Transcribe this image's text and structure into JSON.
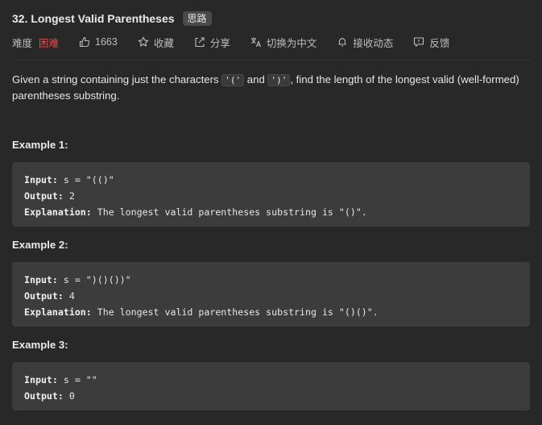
{
  "problem": {
    "title": "32. Longest Valid Parentheses",
    "tag": "思路"
  },
  "meta": {
    "difficulty_label": "难度",
    "difficulty_value": "困难",
    "likes": "1663",
    "favorite": "收藏",
    "share": "分享",
    "translate": "切换为中文",
    "subscribe": "接收动态",
    "feedback": "反馈"
  },
  "description": {
    "part1": "Given a string containing just the characters ",
    "code1": "'('",
    "part2": " and ",
    "code2": "')'",
    "part3": ", find the length of the longest valid (well-formed) parentheses substring."
  },
  "examples": [
    {
      "heading": "Example 1:",
      "input_label": "Input:",
      "input": " s = \"(()\"",
      "output_label": "Output:",
      "output": " 2",
      "explanation_label": "Explanation:",
      "explanation": " The longest valid parentheses substring is \"()\"."
    },
    {
      "heading": "Example 2:",
      "input_label": "Input:",
      "input": " s = \")()())\"",
      "output_label": "Output:",
      "output": " 4",
      "explanation_label": "Explanation:",
      "explanation": " The longest valid parentheses substring is \"()()\"."
    },
    {
      "heading": "Example 3:",
      "input_label": "Input:",
      "input": " s = \"\"",
      "output_label": "Output:",
      "output": " 0"
    }
  ],
  "colors": {
    "background": "#282828",
    "code_block": "#3c3c3c",
    "difficulty_hard": "#ef4743"
  }
}
